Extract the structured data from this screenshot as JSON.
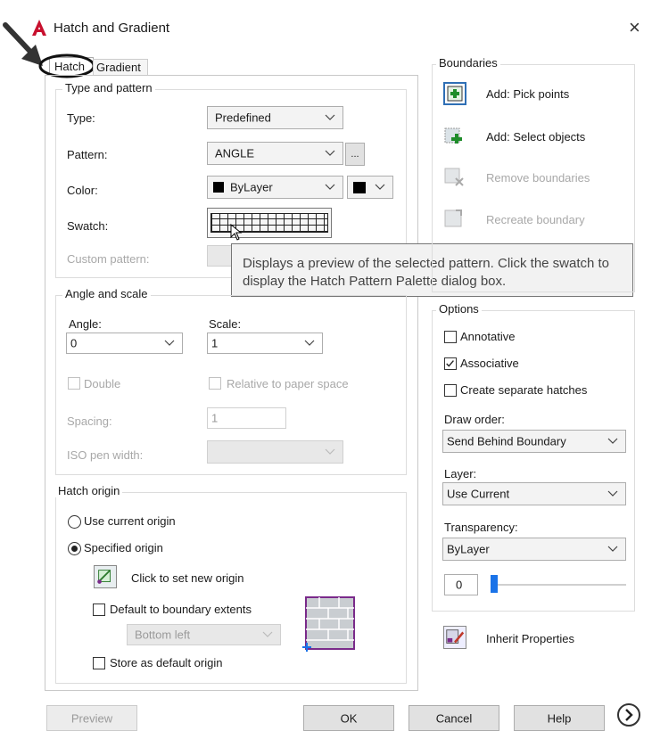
{
  "window": {
    "title": "Hatch and Gradient",
    "close_glyph": "×"
  },
  "tabs": [
    {
      "label": "Hatch"
    },
    {
      "label": "Gradient"
    }
  ],
  "type_pattern": {
    "title": "Type and pattern",
    "type_label": "Type:",
    "type_value": "Predefined",
    "pattern_label": "Pattern:",
    "pattern_value": "ANGLE",
    "pattern_browse": "...",
    "color_label": "Color:",
    "color_value": "ByLayer",
    "swatch_label": "Swatch:",
    "custom_label": "Custom pattern:"
  },
  "tooltip": {
    "line1": "Displays a preview of the selected pattern. Click the swatch to",
    "line2": "display the Hatch Pattern Palette dialog box."
  },
  "angle_scale": {
    "title": "Angle and scale",
    "angle_label": "Angle:",
    "angle_value": "0",
    "scale_label": "Scale:",
    "scale_value": "1",
    "double_label": "Double",
    "relative_label": "Relative to paper space",
    "spacing_label": "Spacing:",
    "spacing_value": "1",
    "iso_label": "ISO pen width:"
  },
  "hatch_origin": {
    "title": "Hatch origin",
    "use_current": "Use current origin",
    "specified": "Specified origin",
    "click_set": "Click to set new origin",
    "default_extents": "Default to boundary extents",
    "position_value": "Bottom left",
    "store_default": "Store as default origin"
  },
  "boundaries": {
    "title": "Boundaries",
    "pick_points": "Add: Pick points",
    "select_objects": "Add: Select objects",
    "remove": "Remove boundaries",
    "recreate": "Recreate boundary"
  },
  "options": {
    "title": "Options",
    "annotative": "Annotative",
    "associative": "Associative",
    "separate": "Create separate hatches",
    "draw_order_label": "Draw order:",
    "draw_order_value": "Send Behind Boundary",
    "layer_label": "Layer:",
    "layer_value": "Use Current",
    "transparency_label": "Transparency:",
    "transparency_value": "ByLayer",
    "transparency_amount": "0"
  },
  "inherit": "Inherit Properties",
  "footer": {
    "preview": "Preview",
    "ok": "OK",
    "cancel": "Cancel",
    "help": "Help"
  },
  "colors": {
    "accent": "#1a73e8",
    "autocad_red": "#c8102e",
    "border": "#dcdcdc"
  }
}
